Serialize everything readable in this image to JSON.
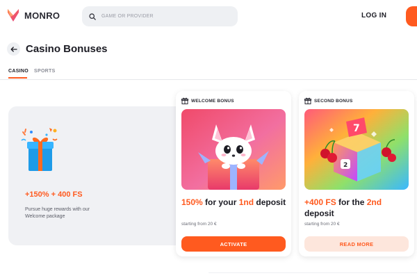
{
  "header": {
    "logo_text": "MONRO",
    "search_placeholder": "GAME OR PROVIDER",
    "login_label": "LOG IN"
  },
  "page": {
    "title": "Casino Bonuses"
  },
  "tabs": [
    {
      "label": "CASINO",
      "active": true
    },
    {
      "label": "SPORTS",
      "active": false
    }
  ],
  "promo": {
    "amount": "+150% + 400 FS",
    "description": "Pursue huge rewards with our Welcome package"
  },
  "cards": [
    {
      "label": "WELCOME BONUS",
      "title_parts": [
        "150%",
        " for your ",
        "1nd",
        " deposit"
      ],
      "subtitle": "starting from 20 €",
      "button_label": "ACTIVATE"
    },
    {
      "label": "SECOND BONUS",
      "title_parts": [
        "+400 FS",
        " for the ",
        "2nd",
        " deposit"
      ],
      "subtitle": "starting from 20 €",
      "button_label": "READ MORE"
    }
  ],
  "colors": {
    "accent": "#ff5a1f",
    "accent_soft": "#fde6dc",
    "panel_bg": "#f0f1f4"
  },
  "icons": [
    "monro-logo-icon",
    "search-icon",
    "back-arrow-icon",
    "gift-icon",
    "gift-box-illustration"
  ]
}
